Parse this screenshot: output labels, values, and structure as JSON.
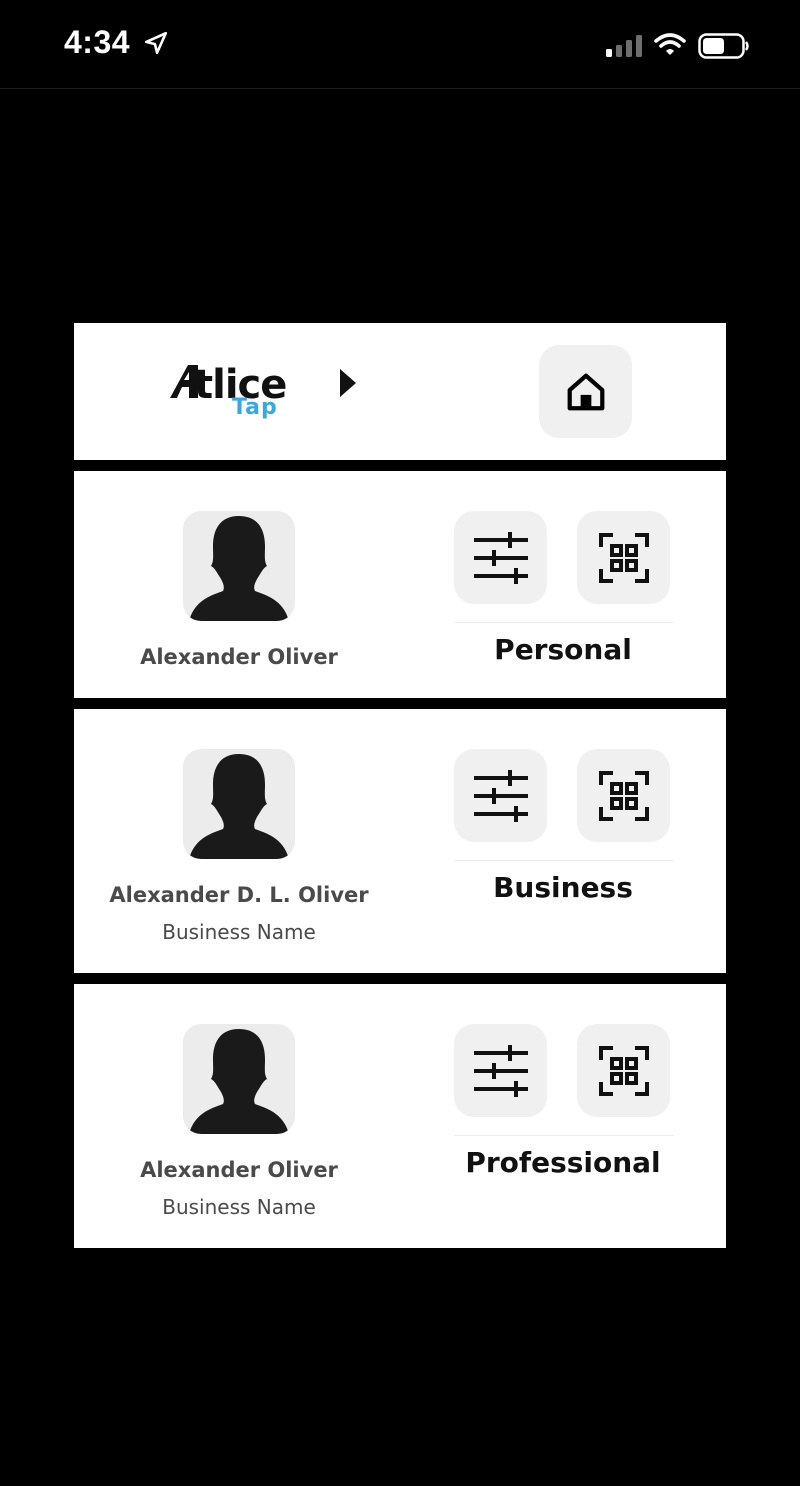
{
  "status_bar": {
    "time": "4:34"
  },
  "header": {
    "logo_text": "Atlice",
    "logo_sub": "Tap"
  },
  "cards": [
    {
      "name": "Alexander Oliver",
      "subtitle": "",
      "type": "Personal"
    },
    {
      "name": "Alexander D. L. Oliver",
      "subtitle": "Business Name",
      "type": "Business"
    },
    {
      "name": "Alexander Oliver",
      "subtitle": "Business Name",
      "type": "Professional"
    }
  ],
  "icons": {
    "home": "home-icon",
    "settings": "sliders-icon",
    "qr": "qr-code-icon",
    "avatar": "person-silhouette-icon"
  },
  "colors": {
    "background": "#000000",
    "panel": "#ffffff",
    "button": "#f0f0f0",
    "logo_accent": "#3aa8e0"
  }
}
